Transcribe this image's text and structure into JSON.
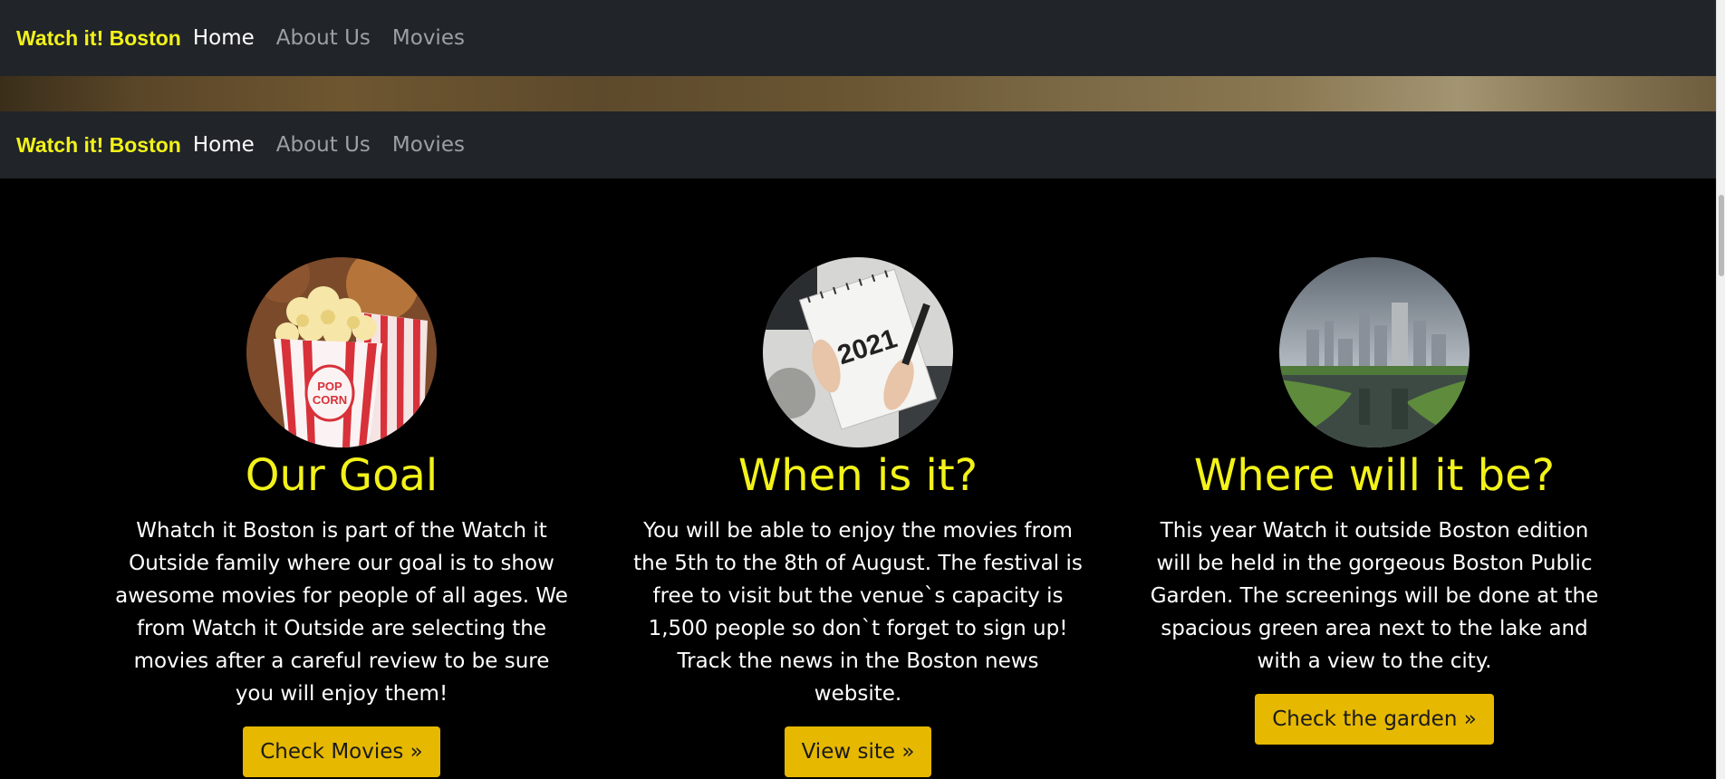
{
  "navbar": {
    "brand": "Watch it! Boston",
    "links": [
      {
        "label": "Home",
        "active": true
      },
      {
        "label": "About Us",
        "active": false
      },
      {
        "label": "Movies",
        "active": false
      }
    ]
  },
  "colors": {
    "brand": "#f2f21a",
    "navbar_bg": "#212529",
    "button_bg": "#e6b800",
    "page_bg": "#000000"
  },
  "features": [
    {
      "image": "popcorn-image",
      "title": "Our Goal",
      "text": "Whatch it Boston is part of the Watch it Outside family where our goal is to show awesome movies for people of all ages. We from Watch it Outside are selecting the movies after a careful review to be sure you will enjoy them!",
      "button": "Check Movies »"
    },
    {
      "image": "calendar-2021-image",
      "title": "When is it?",
      "text": "You will be able to enjoy the movies from the 5th to the 8th of August. The festival is free to visit but the venue`s capacity is 1,500 people so don`t forget to sign up! Track the news in the Boston news website.",
      "button": "View site »"
    },
    {
      "image": "boston-garden-image",
      "title": "Where will it be?",
      "text": "This year Watch it outside Boston edition will be held in the gorgeous Boston Public Garden. The screenings will be done at the spacious green area next to the lake and with a view to the city.",
      "button": "Check the garden »"
    }
  ],
  "calendar_label": "2021",
  "popcorn_label": "POP CORN"
}
